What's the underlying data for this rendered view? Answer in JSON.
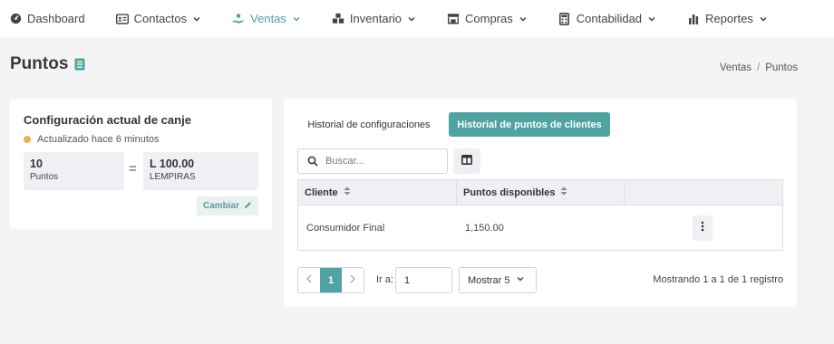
{
  "nav": [
    {
      "label": "Dashboard",
      "icon": "dashboard-icon",
      "dropdown": false,
      "active": false
    },
    {
      "label": "Contactos",
      "icon": "contacts-card-icon",
      "dropdown": true,
      "active": false
    },
    {
      "label": "Ventas",
      "icon": "sales-hand-icon",
      "dropdown": true,
      "active": true
    },
    {
      "label": "Inventario",
      "icon": "boxes-icon",
      "dropdown": true,
      "active": false
    },
    {
      "label": "Compras",
      "icon": "store-icon",
      "dropdown": true,
      "active": false
    },
    {
      "label": "Contabilidad",
      "icon": "calculator-icon",
      "dropdown": true,
      "active": false
    },
    {
      "label": "Reportes",
      "icon": "bar-chart-icon",
      "dropdown": true,
      "active": false
    }
  ],
  "page": {
    "title": "Puntos",
    "title_icon": "book-icon"
  },
  "breadcrumb": {
    "items": [
      "Ventas",
      "Puntos"
    ],
    "separator": "/"
  },
  "config": {
    "title": "Configuración actual de canje",
    "status": "Actualizado hace 6 minutos",
    "points_value": "10",
    "points_unit": "Puntos",
    "equals": "=",
    "money_value": "L 100.00",
    "money_unit": "LEMPIRAS",
    "change_label": "Cambiar"
  },
  "tabs": [
    "Historial de configuraciones",
    "Historial de puntos de clientes"
  ],
  "search": {
    "placeholder": "Buscar..."
  },
  "table": {
    "columns": [
      "Cliente",
      "Puntos disponibles",
      ""
    ],
    "rows": [
      {
        "cliente": "Consumidor Final",
        "puntos": "1,150.00"
      }
    ]
  },
  "pagination": {
    "current": "1",
    "goto_label": "Ir a:",
    "goto_value": "1",
    "show_label": "Mostrar 5",
    "summary": "Mostrando 1 a 1 de 1 registro"
  },
  "colors": {
    "accent": "#4fa3a0",
    "status_dot": "#f0ad4e",
    "background": "#f4f4f5"
  }
}
